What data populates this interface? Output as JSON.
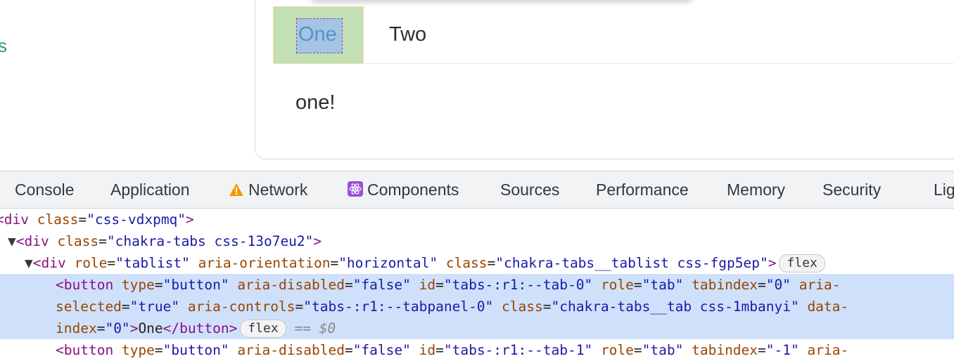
{
  "page": {
    "left_fragment": "s",
    "tabs": [
      {
        "label": "One",
        "selected": true
      },
      {
        "label": "Two",
        "selected": false
      }
    ],
    "panel_text": "one!"
  },
  "devtools": {
    "tabs": [
      {
        "label": "Console"
      },
      {
        "label": "Application"
      },
      {
        "label": "Network",
        "icon": "warning-icon"
      },
      {
        "label": "Components",
        "icon": "react-icon"
      },
      {
        "label": "Sources"
      },
      {
        "label": "Performance"
      },
      {
        "label": "Memory"
      },
      {
        "label": "Security"
      },
      {
        "label": "Lig"
      }
    ],
    "elements": {
      "line1": {
        "tag_open": "<div ",
        "a1": "class",
        "v1": "\"css-vdxpmq\"",
        "close": ">"
      },
      "line2": {
        "tag_open": "<div ",
        "a1": "class",
        "v1": "\"chakra-tabs css-13o7eu2\"",
        "close": ">"
      },
      "line3": {
        "tag_open": "<div ",
        "a1": "role",
        "v1": "\"tablist\"",
        "a2": "aria-orientation",
        "v2": "\"horizontal\"",
        "a3": "class",
        "v3": "\"chakra-tabs__tablist css-fgp5ep\"",
        "close": ">",
        "badge": "flex"
      },
      "line4": {
        "tag_open": "<button ",
        "a1": "type",
        "v1": "\"button\"",
        "a2": "aria-disabled",
        "v2": "\"false\"",
        "a3": "id",
        "v3": "\"tabs-:r1:--tab-0\"",
        "a4": "role",
        "v4": "\"tab\"",
        "a5": "tabindex",
        "v5": "\"0\"",
        "a6": "aria-"
      },
      "line5": {
        "a1": "selected",
        "v1": "\"true\"",
        "a2": "aria-controls",
        "v2": "\"tabs-:r1:--tabpanel-0\"",
        "a3": "class",
        "v3": "\"chakra-tabs__tab css-1mbanyi\"",
        "a4": "data-"
      },
      "line6": {
        "a1": "index",
        "v1": "\"0\"",
        "close": ">",
        "text": "One",
        "end_tag": "</button>",
        "badge": "flex",
        "eq": "==",
        "dollar": "$0"
      },
      "line7": {
        "tag_open": "<button ",
        "a1": "type",
        "v1": "\"button\"",
        "a2": "aria-disabled",
        "v2": "\"false\"",
        "a3": "id",
        "v3": "\"tabs-:r1:--tab-1\"",
        "a4": "role",
        "v4": "\"tab\"",
        "a5": "tabindex",
        "v5": "\"-1\"",
        "a6": "aria-"
      }
    }
  },
  "colors": {
    "tab_highlight_margin": "#c3dfb4",
    "tab_highlight_content": "#a3c4e2",
    "selected_row": "#cfe0fb",
    "tag": "#881280",
    "attr": "#994500",
    "value": "#1a1aa6"
  }
}
